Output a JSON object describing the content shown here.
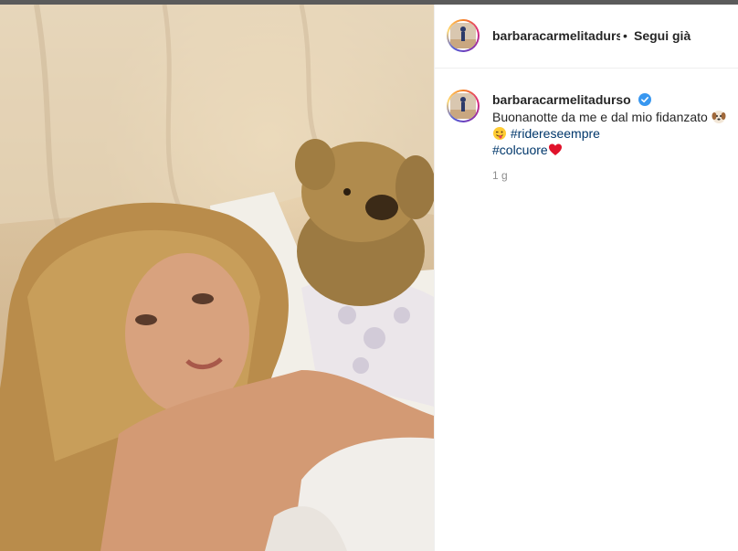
{
  "header": {
    "username": "barbaracarmelitadurso",
    "separator": "•",
    "follow_label": "Segui già"
  },
  "caption": {
    "username": "barbaracarmelitadurso",
    "text_before": "Buonanotte da me e dal mio fidanzato",
    "hashtag_1": "#ridereseempre",
    "hashtag_2": "#colcuore",
    "emojis": [
      "dog-face-emoji",
      "winking-tongue-emoji",
      "red-heart-emoji"
    ],
    "timestamp": "1 g"
  },
  "colors": {
    "hashtag": "#00376b",
    "verified": "#3897f0",
    "muted": "#8e8e8e"
  }
}
